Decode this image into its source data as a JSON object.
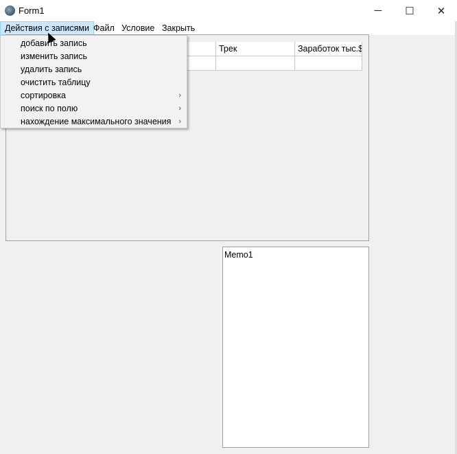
{
  "window": {
    "title": "Form1",
    "minimize": "─",
    "maximize": "☐",
    "close": "✕"
  },
  "menubar": {
    "items": [
      {
        "label": "Действия с записями"
      },
      {
        "label": "Файл"
      },
      {
        "label": "Условие"
      },
      {
        "label": "Закрыть"
      }
    ]
  },
  "dropdown": {
    "items": [
      {
        "label": "добавить запись"
      },
      {
        "label": "изменить запись"
      },
      {
        "label": "удалить запись"
      },
      {
        "label": "очистить таблицу"
      },
      {
        "label": "сортировка",
        "submenu": "›"
      },
      {
        "label": "поиск по полю",
        "submenu": "›"
      },
      {
        "label": "нахождение максимального значения",
        "submenu": "›"
      }
    ]
  },
  "grid": {
    "columns": [
      "",
      "",
      "Трек",
      "Заработок тыс.$"
    ]
  },
  "memo": {
    "text": "Memo1"
  }
}
